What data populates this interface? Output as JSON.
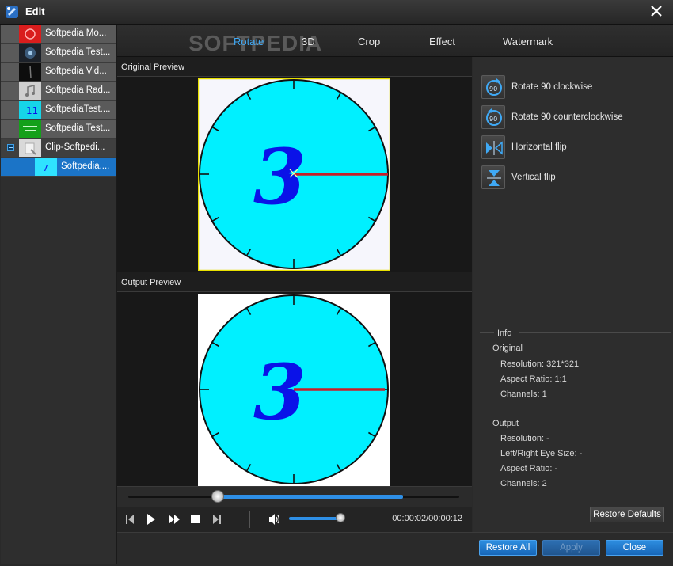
{
  "window": {
    "title": "Edit",
    "close_label": "close"
  },
  "watermark": "SOFTPEDIA",
  "sidebar": {
    "items": [
      {
        "label": "Softpedia Mo...",
        "thumb_color": "#e02020"
      },
      {
        "label": "Softpedia Test...",
        "thumb_color": "#2a2f38"
      },
      {
        "label": "Softpedia Vid...",
        "thumb_color": "#111111"
      },
      {
        "label": "Softpedia Rad...",
        "thumb_color": "#cfcfcf"
      },
      {
        "label": "SoftpediaTest....",
        "thumb_color": "#16d5e8"
      },
      {
        "label": "Softpedia Test...",
        "thumb_color": "#14a01a"
      },
      {
        "label": "Clip-Softpedi...",
        "thumb_color": "#d9d9d9"
      }
    ],
    "child": {
      "label": "Softpedia....",
      "thumb_color": "#2fe3ff"
    }
  },
  "tabs": [
    {
      "label": "Rotate",
      "active": true
    },
    {
      "label": "3D"
    },
    {
      "label": "Crop"
    },
    {
      "label": "Effect"
    },
    {
      "label": "Watermark"
    }
  ],
  "preview": {
    "original_label": "Original Preview",
    "output_label": "Output Preview",
    "clock_number": "3",
    "clock_color": "#00f0ff",
    "digit_color": "#0a12e8",
    "hand_color": "#c81e28"
  },
  "player": {
    "progress": 0.27,
    "buffer": 0.83,
    "volume": 0.9,
    "timecode": "00:00:02/00:00:12"
  },
  "actions": [
    {
      "label": "Rotate 90 clockwise",
      "icon": "rotate-cw-icon"
    },
    {
      "label": "Rotate 90 counterclockwise",
      "icon": "rotate-ccw-icon"
    },
    {
      "label": "Horizontal flip",
      "icon": "flip-horizontal-icon"
    },
    {
      "label": "Vertical flip",
      "icon": "flip-vertical-icon"
    }
  ],
  "info": {
    "title": "Info",
    "original_title": "Original",
    "original_resolution": "Resolution: 321*321",
    "original_aspect": "Aspect Ratio: 1:1",
    "original_channels": "Channels: 1",
    "output_title": "Output",
    "output_resolution": "Resolution: -",
    "output_eye": "Left/Right Eye Size: -",
    "output_aspect": "Aspect Ratio: -",
    "output_channels": "Channels: 2"
  },
  "buttons": {
    "restore_defaults": "Restore Defaults",
    "restore_all": "Restore All",
    "apply": "Apply",
    "close": "Close"
  },
  "colors": {
    "accent": "#1b74c7",
    "active_tab": "#3fa9f5"
  }
}
